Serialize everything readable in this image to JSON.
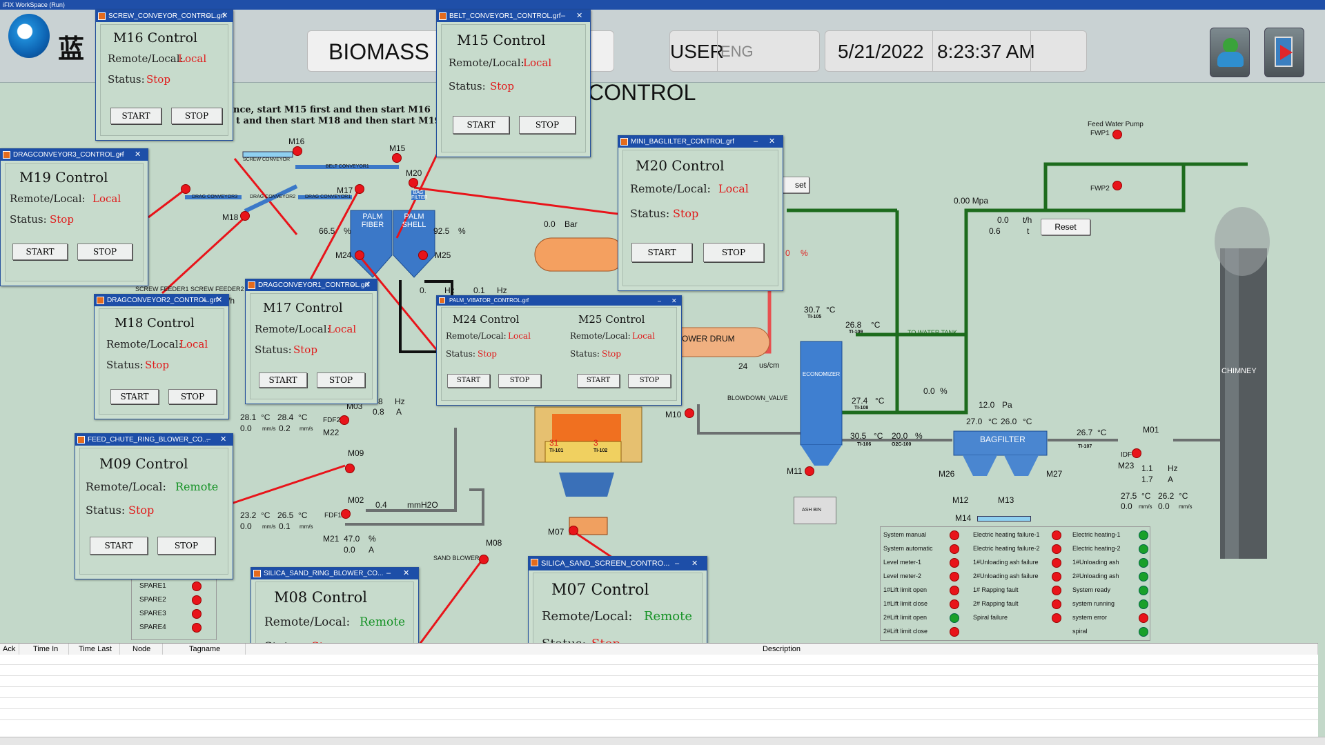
{
  "window_title": "iFIX WorkSpace (Run)",
  "header": {
    "logo_text": "蓝",
    "plant_title": "BIOMASS B",
    "user_label": "USER",
    "user_value": "ENG",
    "date": "5/21/2022",
    "time": "8:23:37 AM"
  },
  "canvas": {
    "subtitle": "R CONTROL",
    "instruction1": "nce, start M15 first and then start M16",
    "instruction2": "t and then start M18 and then start M19",
    "feed_water_pump": "Feed Water Pump",
    "fwp1": "FWP1",
    "fwp2": "FWP2",
    "pressure_mpa": "0.00 Mpa",
    "flow_th": "0.0",
    "flow_unit": "t/h",
    "flow2": "0.6",
    "flow2_unit": "t",
    "reset": "Reset",
    "reset2": "set",
    "m16": "M16",
    "m15": "M15",
    "m19": "M19",
    "m17": "M17",
    "m18": "M18",
    "m20": "M20",
    "m24": "M24",
    "m25": "M25",
    "m09": "M09",
    "m02": "M02",
    "m08": "M08",
    "m07": "M07",
    "m10": "M10",
    "m11": "M11",
    "m12": "M12",
    "m13": "M13",
    "m14": "M14",
    "m26": "M26",
    "m27": "M27",
    "m01": "M01",
    "m23": "M23",
    "m22": "M22",
    "m21": "M21",
    "m03": "M03",
    "screw_conveyor": "SCREW CONVEYOR",
    "belt_conveyor1": "BELT CONVEYOR1",
    "drag_conveyor3": "DRAG CONVEYOR3",
    "drag_conveyor2": "DRAG CONVEYOR2",
    "drag_conveyor1": "DRAG CONVEYOR1",
    "bag_filter": "BAG FILTER",
    "palm_fiber": "PALM FIBER",
    "palm_shell": "PALM SHELL",
    "vibrator": "VIBRATOR",
    "pct_fiber": "66.5",
    "pct_shell": "92.5",
    "pct": "%",
    "bar_value": "0.0",
    "bar_unit": "Bar",
    "hz_val": "0.1",
    "hz": "Hz",
    "screw_feeder1": "SCREW FEEDER1",
    "screw_feeder2": "SCREW FEEDER2",
    "power_drum": "OWER DRUM",
    "conductivity": "24",
    "conductivity_unit": "us/cm",
    "blowdown_valve": "BLOWDOWN_VALVE",
    "economizer": "ECONOMIZER",
    "chimney": "CHIMNEY",
    "bagfilter": "BAGFILTER",
    "ash_bin": "ASH BIN",
    "to_water_tank": "TO WATER TANK",
    "ti105": "30.7",
    "ti105_tag": "TI-105",
    "ti109": "26.8",
    "ti109_tag": "TI-109",
    "ti108": "27.4",
    "ti108_tag": "TI-108",
    "ti106": "30.5",
    "ti106_tag": "TI-106",
    "o2": "20.0",
    "o2_tag": "O2C-100",
    "ti107": "26.7",
    "ti107_tag": "TI-107",
    "valve_pct": "0.0",
    "bagfilter_pa": "12.0",
    "pa": "Pa",
    "bf_t1": "27.0",
    "bf_t2": "26.0",
    "degc": "°C",
    "fdf2_t1": "28.1",
    "fdf2_t2": "28.4",
    "fdf2_v1": "0.0",
    "fdf2_v2": "0.2",
    "mms": "mm/s",
    "fdf2": "FDF2",
    "fdf1": "FDF1",
    "m03_hz": "8",
    "m03_a": "0.8",
    "a": "A",
    "fdf1_t1": "23.2",
    "fdf1_t2": "26.5",
    "fdf1_v1": "0.0",
    "fdf1_v2": "0.1",
    "m02_val": "0.4",
    "mmh2o": "mmH2O",
    "m21_pct": "47.0",
    "m21_a": "0.0",
    "sand_blower": "SAND BLOWER",
    "ti101": "31",
    "ti102": "3",
    "ti101_tag": "TI-101",
    "ti102_tag": "TI-102",
    "idf": "IDF",
    "idf_hz": "1.1",
    "idf_a": "1.7",
    "idf_t1": "27.5",
    "idf_t2": "26.2",
    "idf_v1": "0.0",
    "idf_v2": "0.0",
    "spares": [
      "SPARE1",
      "SPARE2",
      "SPARE3",
      "SPARE4"
    ],
    "hz_row": "0.",
    "hz_small": "Hz",
    "pct_red": "0",
    "pct_red_u": "%",
    "nh": "/h"
  },
  "status_panel": {
    "col1": [
      "System manual",
      "System automatic",
      "Level meter-1",
      "Level meter-2",
      "1#Lift limit open",
      "1#Lift limit close",
      "2#Lift limit open",
      "2#Lift limit close"
    ],
    "col1_state": [
      "red",
      "red",
      "red",
      "red",
      "red",
      "red",
      "green",
      "red"
    ],
    "col2": [
      "Electric heating failure-1",
      "Electric heating failure-2",
      "1#Unloading ash failure",
      "2#Unloading ash failure",
      "1# Rapping fault",
      "2# Rapping fault",
      "Spiral failure"
    ],
    "col2_state": [
      "red",
      "red",
      "red",
      "red",
      "red",
      "red",
      "red"
    ],
    "col3": [
      "Electric heating-1",
      "Electric heating-2",
      "1#Unloading ash",
      "2#Unloading ash",
      "System ready",
      "system running",
      "system error",
      "spiral"
    ],
    "col3_state": [
      "green",
      "green",
      "green",
      "green",
      "green",
      "green",
      "red",
      "green"
    ]
  },
  "common": {
    "remote_local": "Remote/Local:",
    "status": "Status:",
    "start": "START",
    "stop": "STOP",
    "local": "Local",
    "remote": "Remote",
    "stop_state": "Stop",
    "min": "–",
    "close": "✕"
  },
  "windows": {
    "m16": {
      "file": "SCREW_CONVEYOR_CONTROL.grf",
      "title": "M16 Control",
      "mode": "Local",
      "state": "Stop"
    },
    "m15": {
      "file": "BELT_CONVEYOR1_CONTROL.grf",
      "title": "M15 Control",
      "mode": "Local",
      "state": "Stop"
    },
    "m19": {
      "file": "DRAGCONVEYOR3_CONTROL.grf",
      "title": "M19 Control",
      "mode": "Local",
      "state": "Stop"
    },
    "m20": {
      "file": "MINI_BAGLILTER_CONTROL.grf",
      "title": "M20 Control",
      "mode": "Local",
      "state": "Stop"
    },
    "m18": {
      "file": "DRAGCONVEYOR2_CONTROL.grf",
      "title": "M18 Control",
      "mode": "Local",
      "state": "Stop"
    },
    "m17": {
      "file": "DRAGCONVEYOR1_CONTROL.grf",
      "title": "M17 Control",
      "mode": "Local",
      "state": "Stop"
    },
    "m2425": {
      "file": "PALM_VIBATOR_CONTROL.grf",
      "title1": "M24 Control",
      "title2": "M25 Control",
      "mode1": "Local",
      "mode2": "Local",
      "state1": "Stop",
      "state2": "Stop"
    },
    "m09": {
      "file": "FEED_CHUTE_RING_BLOWER_CO...",
      "title": "M09 Control",
      "mode": "Remote",
      "state": "Stop"
    },
    "m08": {
      "file": "SILICA_SAND_RING_BLOWER_CO...",
      "title": "M08 Control",
      "mode": "Remote",
      "state": "Stop"
    },
    "m07": {
      "file": "SILICA_SAND_SCREEN_CONTRO...",
      "title": "M07 Control",
      "mode": "Remote",
      "state": "Stop"
    }
  },
  "alarm_table": {
    "columns": [
      "Ack",
      "Time In",
      "Time Last",
      "Node",
      "Tagname",
      "Description"
    ]
  },
  "colors": {
    "pipe_green": "#1d6b1d",
    "signal_red": "#e8141a",
    "window_title_blue": "#1d4ea8",
    "panel_bg": "#c3d8c9"
  }
}
